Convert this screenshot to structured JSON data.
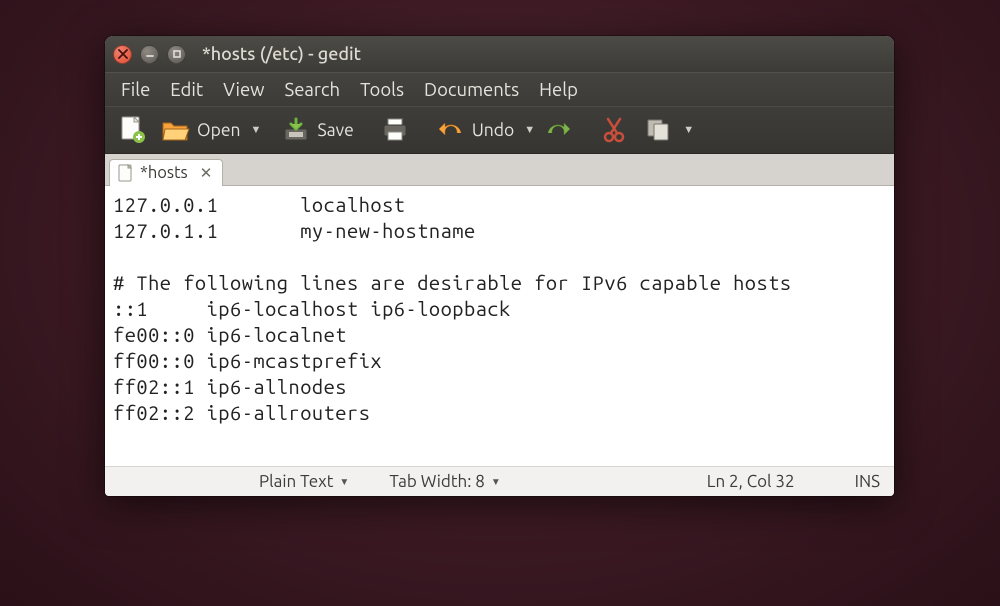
{
  "window": {
    "title": "*hosts (/etc) - gedit"
  },
  "menubar": {
    "file": "File",
    "edit": "Edit",
    "view": "View",
    "search": "Search",
    "tools": "Tools",
    "documents": "Documents",
    "help": "Help"
  },
  "toolbar": {
    "open": "Open",
    "save": "Save",
    "undo": "Undo"
  },
  "tab": {
    "label": "*hosts"
  },
  "editor": {
    "content": "127.0.0.1       localhost\n127.0.1.1       my-new-hostname\n\n# The following lines are desirable for IPv6 capable hosts\n::1     ip6-localhost ip6-loopback\nfe00::0 ip6-localnet\nff00::0 ip6-mcastprefix\nff02::1 ip6-allnodes\nff02::2 ip6-allrouters"
  },
  "statusbar": {
    "syntax": "Plain Text",
    "tabwidth": "Tab Width: 8",
    "position": "Ln 2, Col 32",
    "mode": "INS"
  }
}
